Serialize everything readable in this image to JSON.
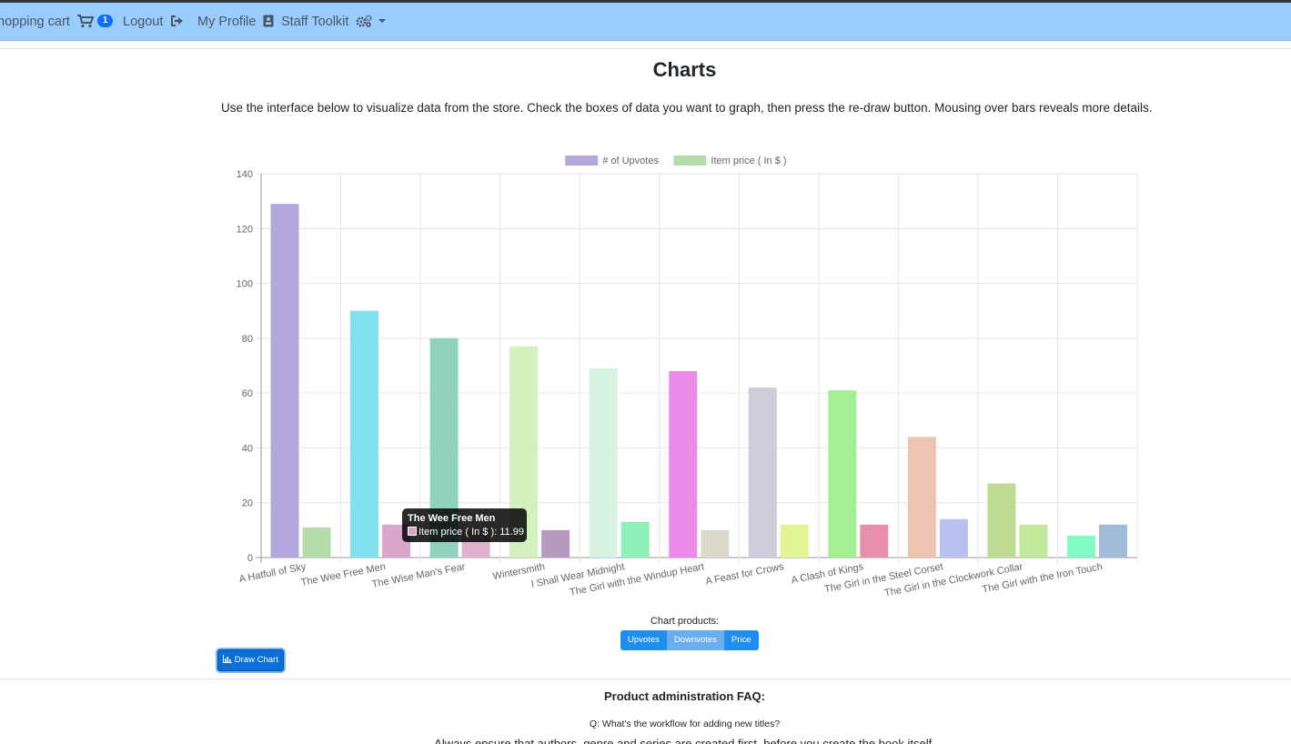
{
  "navbar": {
    "cart_label": "hopping cart",
    "cart_count": "1",
    "logout_label": "Logout",
    "profile_label": "My Profile",
    "staff_label": "Staff Toolkit"
  },
  "page": {
    "title": "Charts",
    "intro": "Use the interface below to visualize data from the store. Check the boxes of data you want to graph, then press the re-draw button. Mousing over bars reveals more details."
  },
  "chart_data": {
    "type": "bar",
    "categories": [
      "A Hatfull of Sky",
      "The Wee Free Men",
      "The Wise Man's Fear",
      "Wintersmith",
      "I Shall Wear Midnight",
      "The Girl with the Windup Heart",
      "A Feast for Crows",
      "A Clash of Kings",
      "The Girl in the Steel Corset",
      "The Girl in the Clockwork Collar",
      "The Girl with the Iron Touch"
    ],
    "series": [
      {
        "name": "# of Upvotes",
        "values": [
          129,
          90,
          80,
          77,
          69,
          68,
          62,
          61,
          44,
          27,
          8
        ]
      },
      {
        "name": "Item price ( In $ )",
        "values": [
          11,
          11.99,
          10,
          10,
          13,
          10,
          12,
          12,
          14,
          12,
          12
        ]
      }
    ],
    "ylim": [
      0,
      140
    ],
    "yticks": [
      0,
      20,
      40,
      60,
      80,
      100,
      120,
      140
    ],
    "grid": true,
    "legend_position": "top",
    "legend_colors": [
      "#b4a7dc",
      "#b5dcaa"
    ],
    "upvote_colors": [
      "#b4a7dc",
      "#80e2ee",
      "#90d2bd",
      "#d3f1bd",
      "#d6f3e1",
      "#ec8aea",
      "#cfcddc",
      "#a6ee94",
      "#eec3b2",
      "#bcdb93",
      "#82fcc4"
    ],
    "price_colors": [
      "#b5dcaa",
      "#dba6cb",
      "#deb1cc",
      "#b69bbf",
      "#8bf1b9",
      "#dad9cc",
      "#e1f597",
      "#e78fad",
      "#bbc1ee",
      "#c0e99b",
      "#a0bcd9"
    ]
  },
  "tooltip": {
    "title": "The Wee Free Men",
    "body": "Item price ( In $ ): 11.99"
  },
  "controls": {
    "chart_products_label": "Chart products:",
    "toggle_upvotes": "Upvotes",
    "toggle_downvotes": "Downvotes",
    "toggle_price": "Price",
    "draw_button": "Draw Chart"
  },
  "faq": {
    "title": "Product administration FAQ:",
    "question": "Q: What's the workflow for adding new titles?",
    "answer": "Always ensure that authors, genre and series are created first, before you create the book itself."
  }
}
